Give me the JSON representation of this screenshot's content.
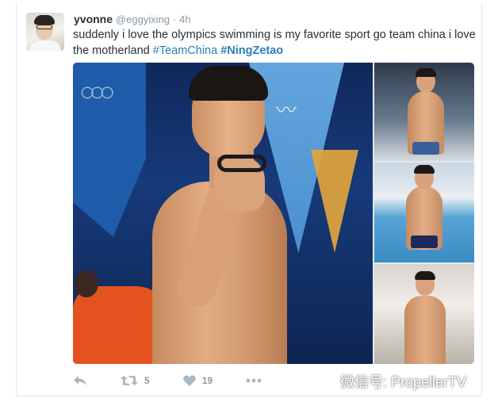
{
  "tweet": {
    "author_name": "yvonne",
    "author_handle": "@eggyixing",
    "separator": "·",
    "time": "4h",
    "text_plain": "suddenly i love the olympics swimming is my favorite sport go team china i love the motherland ",
    "hashtags": [
      "#TeamChina",
      "#NingZetao"
    ],
    "media": {
      "photo_count": 4
    },
    "actions": {
      "reply_icon": "reply-icon",
      "retweet_icon": "retweet-icon",
      "retweet_count": "5",
      "like_icon": "heart-icon",
      "like_count": "19",
      "more_icon": "more-dots-icon"
    }
  },
  "watermark": {
    "icon": "wechat-icon",
    "text": "微信号: PropellerTV"
  },
  "colors": {
    "link": "#2b7bb9",
    "muted": "#8899a6",
    "icon": "#aab8c2",
    "text": "#292f33"
  }
}
